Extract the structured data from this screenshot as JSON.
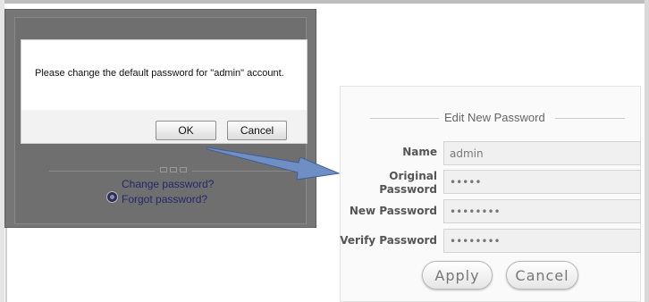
{
  "dialog": {
    "message": "Please change the default password for \"admin\" account.",
    "ok_label": "OK",
    "cancel_label": "Cancel"
  },
  "login_page": {
    "change_password_link": "Change password?",
    "forgot_password_link": "Forgot password?",
    "link_icon": "login-icon"
  },
  "edit_password": {
    "legend": "Edit New Password",
    "fields": {
      "name": {
        "label": "Name",
        "value": "admin"
      },
      "original": {
        "label_line1": "Original",
        "label_line2": "Password",
        "value": "•••••"
      },
      "new": {
        "label": "New Password",
        "value": "••••••••"
      },
      "verify": {
        "label": "Verify Password",
        "value": "••••••••"
      }
    },
    "apply_label": "Apply",
    "cancel_label": "Cancel"
  },
  "colors": {
    "dim_overlay": "#767676",
    "link": "#27276b",
    "arrow": "#5a7fb5"
  }
}
